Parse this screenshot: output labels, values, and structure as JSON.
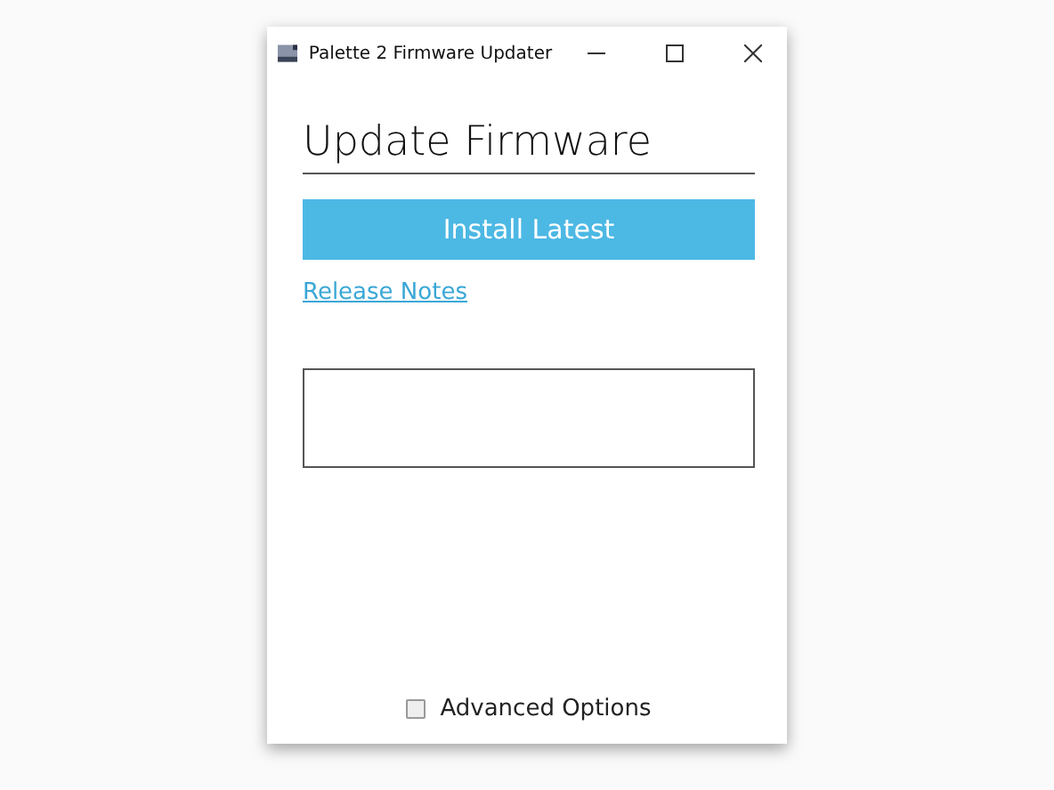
{
  "window": {
    "title": "Palette 2 Firmware Updater"
  },
  "heading": "Update Firmware",
  "install_button": "Install Latest",
  "release_notes_link": "Release Notes",
  "advanced_options": {
    "label": "Advanced Options",
    "checked": false
  }
}
